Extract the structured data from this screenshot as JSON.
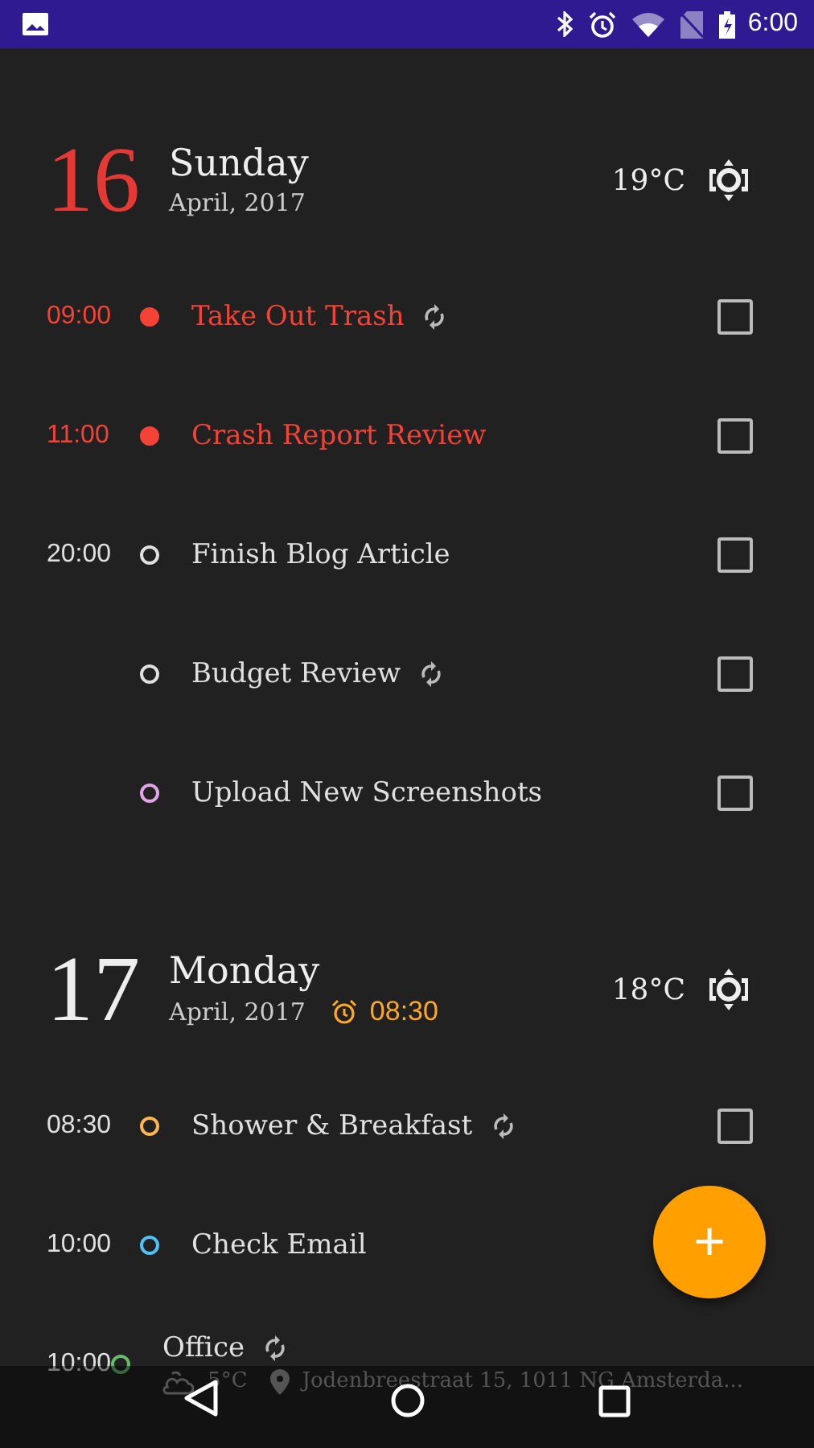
{
  "status_bar": {
    "time": "6:00"
  },
  "days": [
    {
      "day": "16",
      "weekday": "Sunday",
      "month": "April, 2017",
      "today": true,
      "temperature": "19°C",
      "events": [
        {
          "time": "09:00",
          "title": "Take Out Trash",
          "overdue": true,
          "color": "#f44336",
          "repeat": true,
          "checked": false
        },
        {
          "time": "11:00",
          "title": "Crash Report Review",
          "overdue": true,
          "color": "#f44336",
          "repeat": false,
          "checked": false
        },
        {
          "time": "20:00",
          "title": "Finish Blog Article",
          "overdue": false,
          "color": "#e0e0e0",
          "repeat": false,
          "checked": false
        },
        {
          "title": "Budget Review",
          "overdue": false,
          "color": "#e0e0e0",
          "repeat": true,
          "checked": false
        },
        {
          "title": "Upload New Screenshots",
          "overdue": false,
          "color": "#e1a6e8",
          "repeat": false,
          "checked": false
        }
      ]
    },
    {
      "day": "17",
      "weekday": "Monday",
      "month": "April, 2017",
      "today": false,
      "temperature": "18°C",
      "alarm": "08:30",
      "events": [
        {
          "time": "08:30",
          "title": "Shower & Breakfast",
          "overdue": false,
          "color": "#ffb74d",
          "repeat": true,
          "checked": false
        },
        {
          "time": "10:00",
          "title": "Check Email",
          "overdue": false,
          "color": "#4fc3f7",
          "repeat": false
        },
        {
          "time": "10:00",
          "title": "Office",
          "overdue": false,
          "color": "#66bb6a",
          "repeat": true,
          "weather": "5°C",
          "location": "Jodenbreestraat 15, 1011 NG Amsterda..."
        }
      ]
    }
  ],
  "fab": {
    "label": "+"
  }
}
